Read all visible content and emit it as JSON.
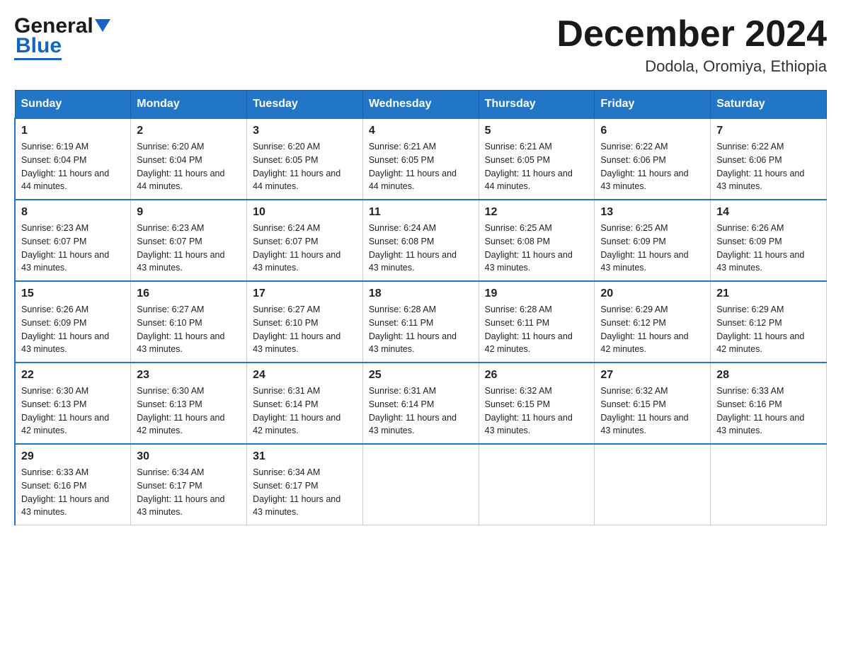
{
  "header": {
    "logo_general": "General",
    "logo_blue": "Blue",
    "month_title": "December 2024",
    "subtitle": "Dodola, Oromiya, Ethiopia"
  },
  "days_of_week": [
    "Sunday",
    "Monday",
    "Tuesday",
    "Wednesday",
    "Thursday",
    "Friday",
    "Saturday"
  ],
  "weeks": [
    [
      {
        "day": "1",
        "sunrise": "6:19 AM",
        "sunset": "6:04 PM",
        "daylight": "11 hours and 44 minutes."
      },
      {
        "day": "2",
        "sunrise": "6:20 AM",
        "sunset": "6:04 PM",
        "daylight": "11 hours and 44 minutes."
      },
      {
        "day": "3",
        "sunrise": "6:20 AM",
        "sunset": "6:05 PM",
        "daylight": "11 hours and 44 minutes."
      },
      {
        "day": "4",
        "sunrise": "6:21 AM",
        "sunset": "6:05 PM",
        "daylight": "11 hours and 44 minutes."
      },
      {
        "day": "5",
        "sunrise": "6:21 AM",
        "sunset": "6:05 PM",
        "daylight": "11 hours and 44 minutes."
      },
      {
        "day": "6",
        "sunrise": "6:22 AM",
        "sunset": "6:06 PM",
        "daylight": "11 hours and 43 minutes."
      },
      {
        "day": "7",
        "sunrise": "6:22 AM",
        "sunset": "6:06 PM",
        "daylight": "11 hours and 43 minutes."
      }
    ],
    [
      {
        "day": "8",
        "sunrise": "6:23 AM",
        "sunset": "6:07 PM",
        "daylight": "11 hours and 43 minutes."
      },
      {
        "day": "9",
        "sunrise": "6:23 AM",
        "sunset": "6:07 PM",
        "daylight": "11 hours and 43 minutes."
      },
      {
        "day": "10",
        "sunrise": "6:24 AM",
        "sunset": "6:07 PM",
        "daylight": "11 hours and 43 minutes."
      },
      {
        "day": "11",
        "sunrise": "6:24 AM",
        "sunset": "6:08 PM",
        "daylight": "11 hours and 43 minutes."
      },
      {
        "day": "12",
        "sunrise": "6:25 AM",
        "sunset": "6:08 PM",
        "daylight": "11 hours and 43 minutes."
      },
      {
        "day": "13",
        "sunrise": "6:25 AM",
        "sunset": "6:09 PM",
        "daylight": "11 hours and 43 minutes."
      },
      {
        "day": "14",
        "sunrise": "6:26 AM",
        "sunset": "6:09 PM",
        "daylight": "11 hours and 43 minutes."
      }
    ],
    [
      {
        "day": "15",
        "sunrise": "6:26 AM",
        "sunset": "6:09 PM",
        "daylight": "11 hours and 43 minutes."
      },
      {
        "day": "16",
        "sunrise": "6:27 AM",
        "sunset": "6:10 PM",
        "daylight": "11 hours and 43 minutes."
      },
      {
        "day": "17",
        "sunrise": "6:27 AM",
        "sunset": "6:10 PM",
        "daylight": "11 hours and 43 minutes."
      },
      {
        "day": "18",
        "sunrise": "6:28 AM",
        "sunset": "6:11 PM",
        "daylight": "11 hours and 43 minutes."
      },
      {
        "day": "19",
        "sunrise": "6:28 AM",
        "sunset": "6:11 PM",
        "daylight": "11 hours and 42 minutes."
      },
      {
        "day": "20",
        "sunrise": "6:29 AM",
        "sunset": "6:12 PM",
        "daylight": "11 hours and 42 minutes."
      },
      {
        "day": "21",
        "sunrise": "6:29 AM",
        "sunset": "6:12 PM",
        "daylight": "11 hours and 42 minutes."
      }
    ],
    [
      {
        "day": "22",
        "sunrise": "6:30 AM",
        "sunset": "6:13 PM",
        "daylight": "11 hours and 42 minutes."
      },
      {
        "day": "23",
        "sunrise": "6:30 AM",
        "sunset": "6:13 PM",
        "daylight": "11 hours and 42 minutes."
      },
      {
        "day": "24",
        "sunrise": "6:31 AM",
        "sunset": "6:14 PM",
        "daylight": "11 hours and 42 minutes."
      },
      {
        "day": "25",
        "sunrise": "6:31 AM",
        "sunset": "6:14 PM",
        "daylight": "11 hours and 43 minutes."
      },
      {
        "day": "26",
        "sunrise": "6:32 AM",
        "sunset": "6:15 PM",
        "daylight": "11 hours and 43 minutes."
      },
      {
        "day": "27",
        "sunrise": "6:32 AM",
        "sunset": "6:15 PM",
        "daylight": "11 hours and 43 minutes."
      },
      {
        "day": "28",
        "sunrise": "6:33 AM",
        "sunset": "6:16 PM",
        "daylight": "11 hours and 43 minutes."
      }
    ],
    [
      {
        "day": "29",
        "sunrise": "6:33 AM",
        "sunset": "6:16 PM",
        "daylight": "11 hours and 43 minutes."
      },
      {
        "day": "30",
        "sunrise": "6:34 AM",
        "sunset": "6:17 PM",
        "daylight": "11 hours and 43 minutes."
      },
      {
        "day": "31",
        "sunrise": "6:34 AM",
        "sunset": "6:17 PM",
        "daylight": "11 hours and 43 minutes."
      },
      null,
      null,
      null,
      null
    ]
  ],
  "labels": {
    "sunrise": "Sunrise:",
    "sunset": "Sunset:",
    "daylight": "Daylight:"
  }
}
